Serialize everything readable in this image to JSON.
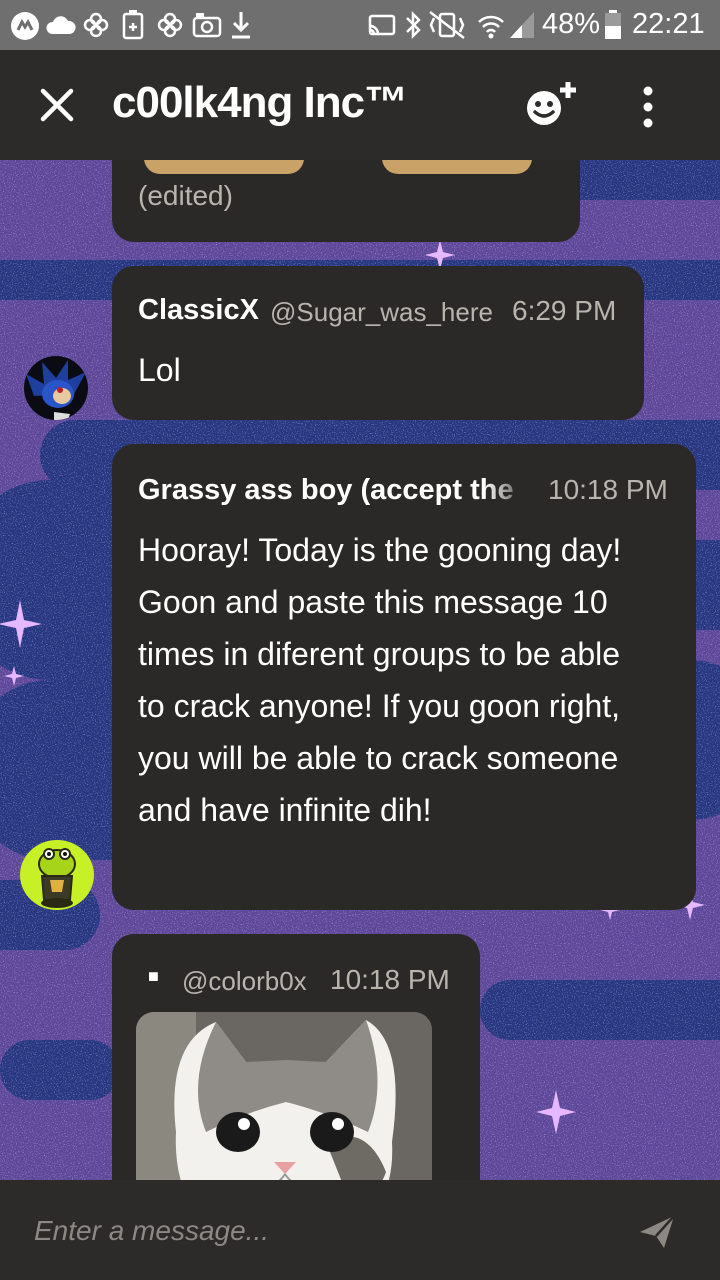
{
  "status_bar": {
    "battery": "48%",
    "time": "22:21",
    "icons": [
      "messenger-icon",
      "cloud-icon",
      "pinwheel-icon",
      "battery-saver-icon",
      "pinwheel-icon",
      "camera-icon",
      "download-icon",
      "cast-icon",
      "bluetooth-icon",
      "vibrate-icon",
      "wifi-icon",
      "signal-icon",
      "battery-icon"
    ]
  },
  "app_bar": {
    "title": "c00lk4ng Inc™",
    "icons": [
      "close-icon",
      "add-member-icon",
      "more-vert-icon"
    ]
  },
  "messages": [
    {
      "type": "partial",
      "edited_label": "(edited)"
    },
    {
      "author": "ClassicX",
      "handle": "@Sugar_was_here",
      "time": "6:29 PM",
      "text": "Lol",
      "avatar": "sonic-avatar"
    },
    {
      "author": "Grassy ass boy (accept the",
      "time": "10:18 PM",
      "text": "Hooray! Today is the gooning day! Goon and paste this message 10 times in diferent groups to be able to crack anyone! If you goon right, you will be able to crack someone and have infinite dih!",
      "avatar": "frog-avatar"
    },
    {
      "author_marker": "■",
      "handle": "@colorb0x",
      "time": "10:18 PM",
      "image": "cat-image"
    }
  ],
  "input": {
    "placeholder": "Enter a message..."
  },
  "colors": {
    "appbar": "#2d2b29",
    "bubble": "#2b2928",
    "background": "#3c3671",
    "status_bar": "#6f6f6f",
    "frog_avatar": "#c8f026"
  }
}
